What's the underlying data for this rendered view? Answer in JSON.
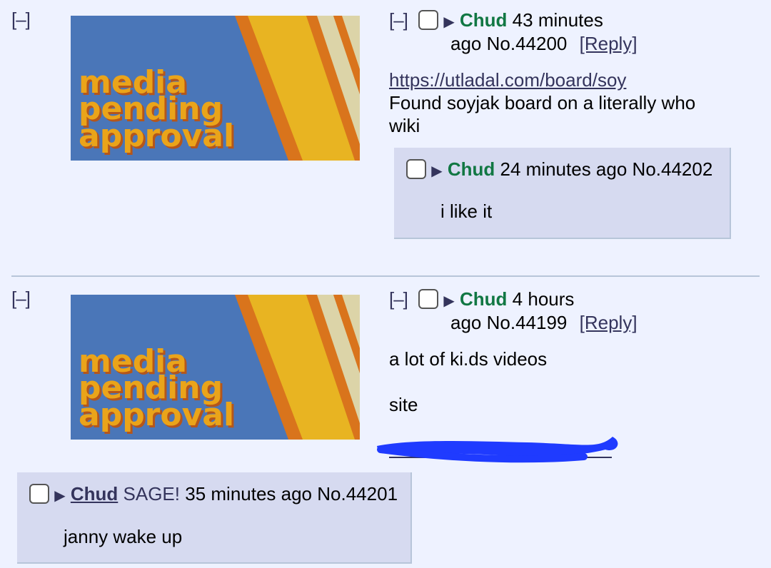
{
  "thumbnail": {
    "text_lines": [
      "media",
      "pending",
      "approval"
    ],
    "colors": {
      "bg": "#4a76b8",
      "text": "#eaa41a",
      "text_shadow": "#b5561a",
      "stripe_orange": "#d9741c",
      "stripe_yellow": "#e8b422",
      "stripe_cream": "#dcd4a8"
    }
  },
  "toggle_label": "[–]",
  "posts": [
    {
      "name": "Chud",
      "time": "43 minutes",
      "time2": "ago",
      "number": "No.44200",
      "reply_label": "[Reply]",
      "link": "https://utladal.com/board/soy",
      "body": "Found soyjak board on a literally who",
      "body2": "wiki"
    },
    {
      "name": "Chud",
      "time": "4 hours",
      "time2": "ago",
      "number": "No.44199",
      "reply_label": "[Reply]",
      "body": "a lot of ki.ds videos",
      "body2": "site"
    }
  ],
  "replies": [
    {
      "name": "Chud",
      "time": "24 minutes ago",
      "number": "No.44202",
      "body": "i like it"
    },
    {
      "name": "Chud",
      "sage": "SAGE!",
      "time": "35 minutes ago",
      "number": "No.44201",
      "body": "janny wake up"
    }
  ],
  "colors": {
    "background": "#eef2ff",
    "reply_bg": "#d6daf0",
    "name_green": "#117743",
    "link": "#34345c",
    "scribble": "#1f3bff"
  }
}
